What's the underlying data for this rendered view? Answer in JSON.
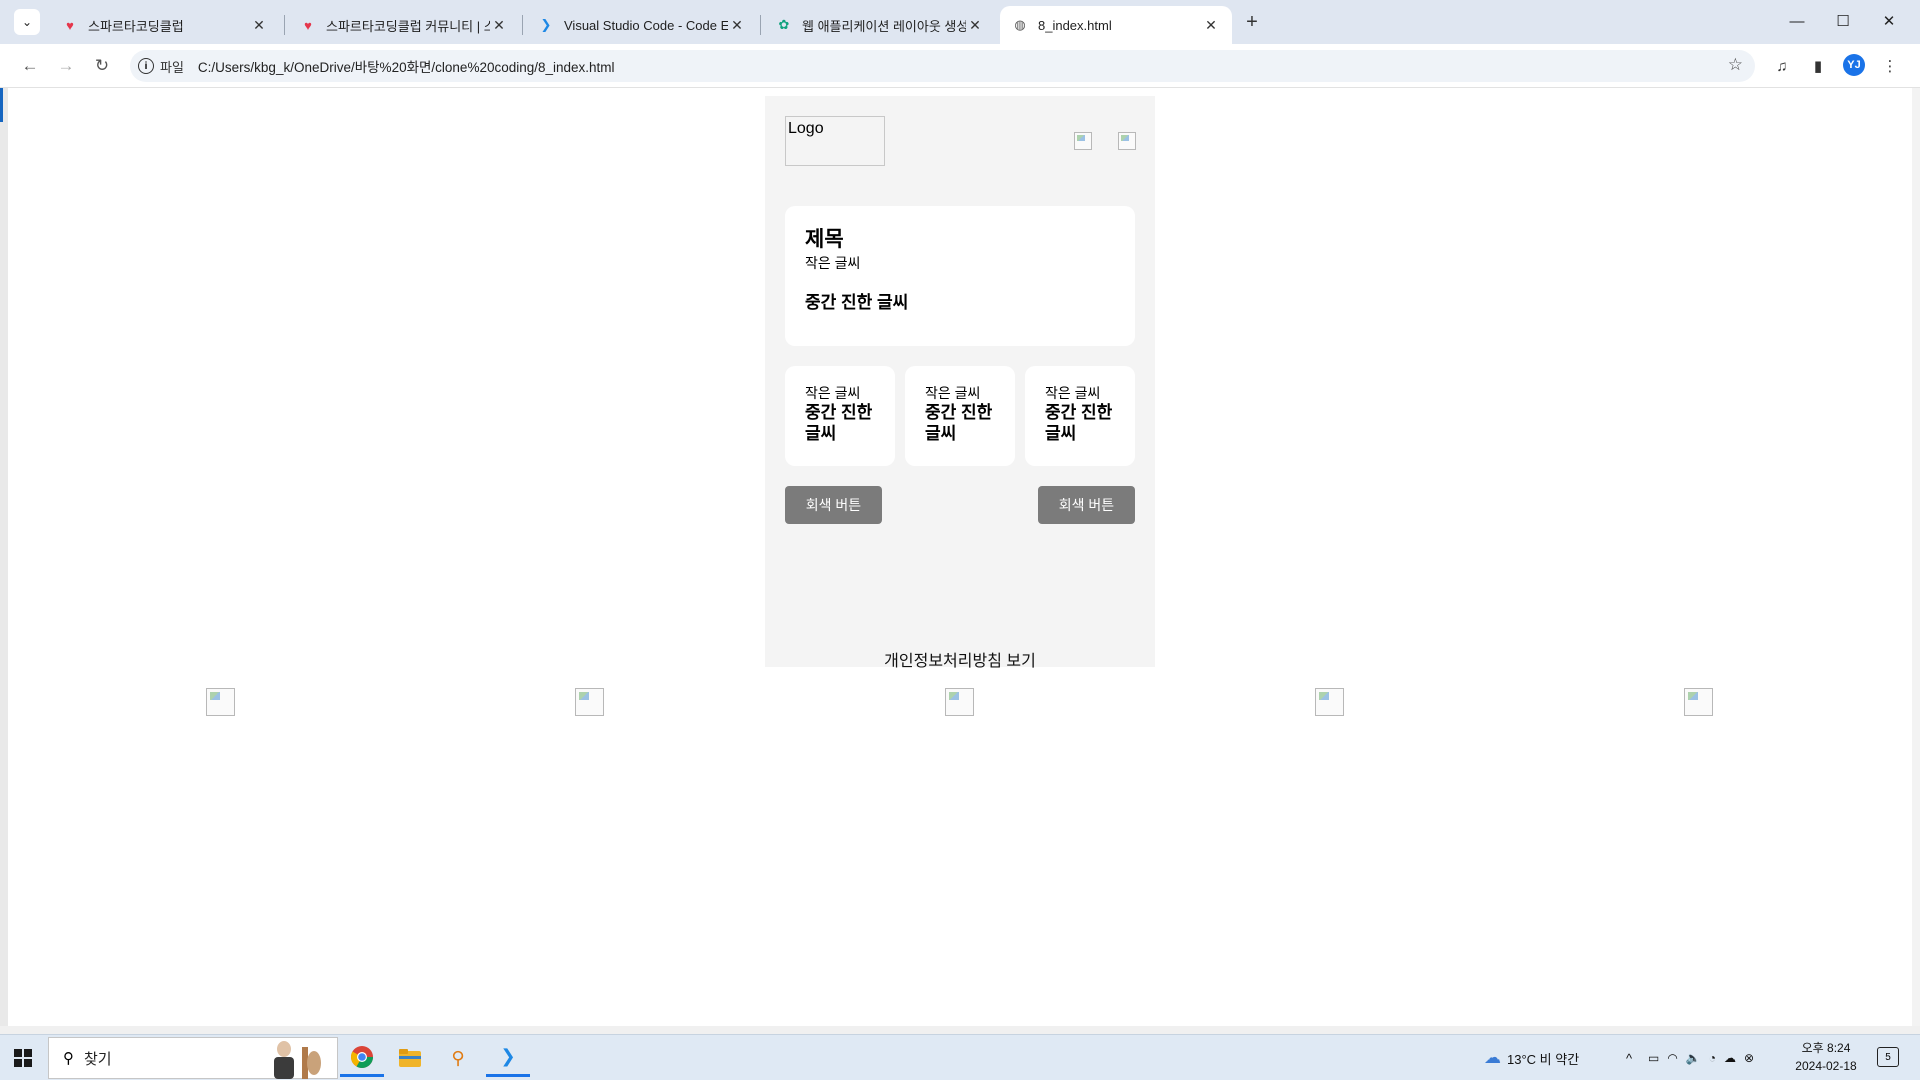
{
  "browser": {
    "tabs": [
      {
        "title": "스파르타코딩클럽",
        "favicon": "heart-icon"
      },
      {
        "title": "스파르타코딩클럽 커뮤니티 | 스",
        "favicon": "heart-icon"
      },
      {
        "title": "Visual Studio Code - Code Edi",
        "favicon": "vscode-icon"
      },
      {
        "title": "웹 애플리케이션 레이아웃 생성",
        "favicon": "chatgpt-icon"
      },
      {
        "title": "8_index.html",
        "favicon": "globe-icon"
      }
    ],
    "address": {
      "scheme_label": "파일",
      "url": "C:/Users/kbg_k/OneDrive/바탕%20화면/clone%20coding/8_index.html"
    },
    "profile_initial": "YJ",
    "accent": "#1a73e8"
  },
  "page": {
    "logo_alt": "Logo",
    "main_card": {
      "title": "제목",
      "small_text": "작은 글씨",
      "mid_text": "중간 진한 글씨"
    },
    "mini_cards": [
      {
        "small_text": "작은 글씨",
        "mid_text": "중간 진한 글씨"
      },
      {
        "small_text": "작은 글씨",
        "mid_text": "중간 진한 글씨"
      },
      {
        "small_text": "작은 글씨",
        "mid_text": "중간 진한 글씨"
      }
    ],
    "buttons": {
      "left": "회색 버튼",
      "right": "회색 버튼",
      "color": "#7b7b7b"
    },
    "privacy_link": "개인정보처리방침 보기"
  },
  "taskbar": {
    "search_placeholder": "찾기",
    "weather": "13°C  비 약간",
    "time": "오후 8:24",
    "date": "2024-02-18",
    "notification_count": "5"
  }
}
